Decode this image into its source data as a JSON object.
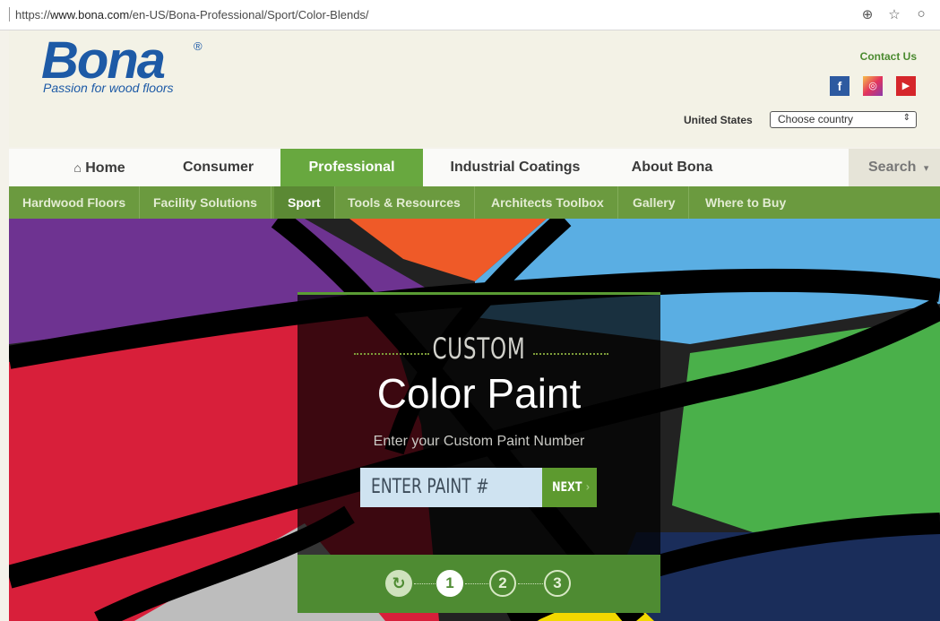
{
  "browser": {
    "url_prefix": "https://",
    "url_host": "www.bona.com",
    "url_path": "/en-US/Bona-Professional/Sport/Color-Blends/",
    "icons": [
      "zoom-icon",
      "star-icon",
      "extension-icon"
    ]
  },
  "header": {
    "logo_text": "Bona",
    "logo_reg": "®",
    "tagline": "Passion for wood floors",
    "contact": "Contact Us",
    "social": [
      {
        "name": "facebook-icon",
        "glyph": "f"
      },
      {
        "name": "instagram-icon",
        "glyph": "◎"
      },
      {
        "name": "youtube-icon",
        "glyph": "▶"
      }
    ],
    "country_label": "United States",
    "country_select": "Choose country"
  },
  "nav": {
    "items": [
      {
        "label": "Home",
        "icon": "home-icon"
      },
      {
        "label": "Consumer"
      },
      {
        "label": "Professional",
        "active": true
      },
      {
        "label": "Industrial Coatings"
      },
      {
        "label": "About Bona"
      }
    ],
    "search": "Search"
  },
  "subnav": {
    "items": [
      {
        "label": "Hardwood Floors"
      },
      {
        "label": "Facility Solutions"
      },
      {
        "label": "Sport",
        "active": true
      },
      {
        "label": "Tools & Resources"
      },
      {
        "label": "Architects Toolbox"
      },
      {
        "label": "Gallery"
      },
      {
        "label": "Where to Buy"
      }
    ]
  },
  "hero": {
    "eyebrow": "CUSTOM",
    "title": "Color Paint",
    "subtitle": "Enter your Custom Paint Number",
    "input_placeholder": "ENTER PAINT #",
    "next_label": "NEXT",
    "steps": [
      "1",
      "2",
      "3"
    ],
    "active_step": "1"
  },
  "colors": {
    "accent_green": "#68a83f",
    "brand_blue": "#1d5aa6"
  }
}
